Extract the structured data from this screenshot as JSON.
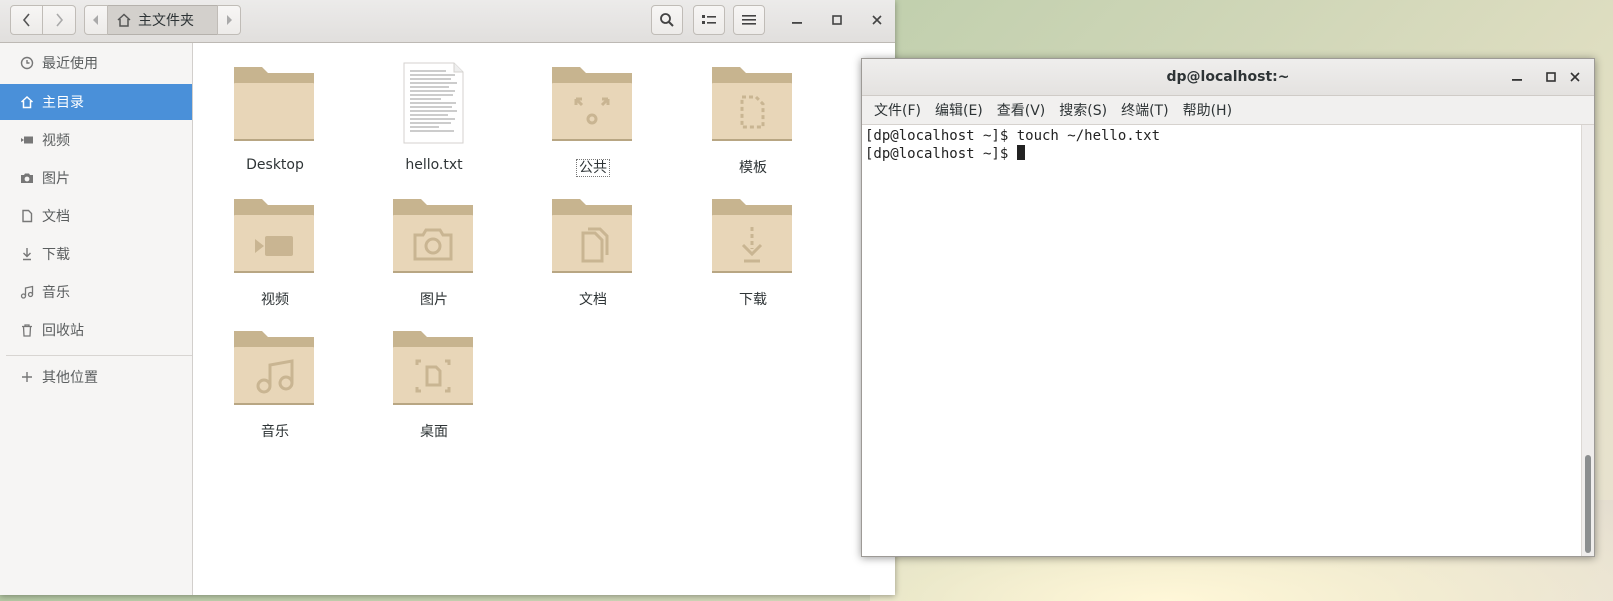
{
  "file_manager": {
    "breadcrumb": "主文件夹",
    "sidebar": [
      {
        "label": "最近使用",
        "icon": "clock-icon"
      },
      {
        "label": "主目录",
        "icon": "home-icon",
        "active": true
      },
      {
        "label": "视频",
        "icon": "video-icon"
      },
      {
        "label": "图片",
        "icon": "camera-icon"
      },
      {
        "label": "文档",
        "icon": "document-icon"
      },
      {
        "label": "下载",
        "icon": "download-icon"
      },
      {
        "label": "音乐",
        "icon": "music-icon"
      },
      {
        "label": "回收站",
        "icon": "trash-icon"
      },
      {
        "label": "其他位置",
        "icon": "plus-icon"
      }
    ],
    "files": [
      {
        "name": "Desktop",
        "type": "folder",
        "emblem": "none"
      },
      {
        "name": "hello.txt",
        "type": "text-file"
      },
      {
        "name": "公共",
        "type": "folder",
        "emblem": "share-icon",
        "focused": true
      },
      {
        "name": "模板",
        "type": "folder",
        "emblem": "template-icon"
      },
      {
        "name": "视频",
        "type": "folder",
        "emblem": "video-icon"
      },
      {
        "name": "图片",
        "type": "folder",
        "emblem": "camera-icon"
      },
      {
        "name": "文档",
        "type": "folder",
        "emblem": "document-icon"
      },
      {
        "name": "下载",
        "type": "folder",
        "emblem": "download-icon"
      },
      {
        "name": "音乐",
        "type": "folder",
        "emblem": "music-icon"
      },
      {
        "name": "桌面",
        "type": "folder",
        "emblem": "desktop-icon"
      }
    ]
  },
  "terminal": {
    "title": "dp@localhost:~",
    "menu": [
      "文件(F)",
      "编辑(E)",
      "查看(V)",
      "搜索(S)",
      "终端(T)",
      "帮助(H)"
    ],
    "lines": [
      "[dp@localhost ~]$ touch ~/hello.txt",
      "[dp@localhost ~]$ "
    ]
  },
  "colors": {
    "accent": "#4a90d9",
    "folder": "#e8d6b8",
    "folder_tab": "#c7b48f"
  }
}
